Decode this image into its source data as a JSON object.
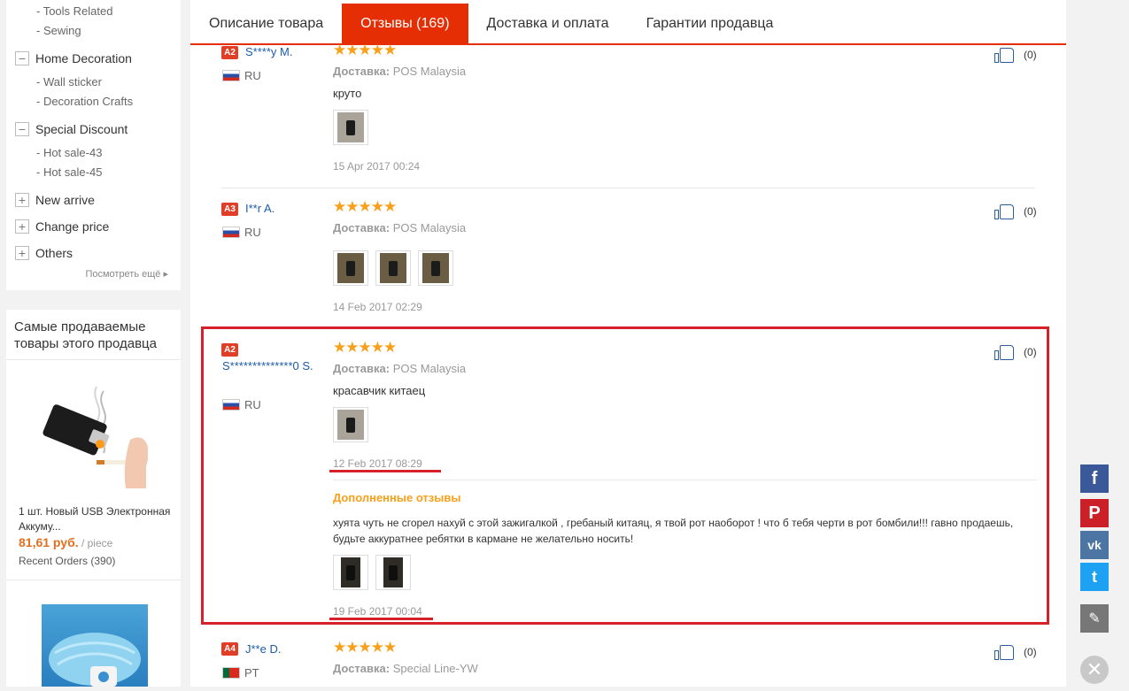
{
  "sidebar": {
    "subs_top": [
      "- Tools Related",
      "- Sewing"
    ],
    "home_decoration": {
      "label": "Home Decoration",
      "toggle": "−",
      "subs": [
        "- Wall sticker",
        "- Decoration Crafts"
      ]
    },
    "special_discount": {
      "label": "Special Discount",
      "toggle": "−",
      "subs": [
        "- Hot sale-43",
        "- Hot sale-45"
      ]
    },
    "new_arrive": {
      "label": "New arrive",
      "toggle": "+"
    },
    "change_price": {
      "label": "Change price",
      "toggle": "+"
    },
    "others": {
      "label": "Others",
      "toggle": "+"
    },
    "more": "Посмотреть ещё ▸"
  },
  "bestsellers": {
    "title": "Самые продаваемые товары этого продавца",
    "product": {
      "name": "1 шт. Новый USB Электронная Аккуму...",
      "price": "81,61 руб.",
      "unit": " / piece",
      "orders": "Recent Orders (390)"
    }
  },
  "tabs": [
    "Описание товара",
    "Отзывы (169)",
    "Доставка и оплата",
    "Гарантии продавца"
  ],
  "active_tab": 1,
  "labels": {
    "delivery": "Доставка:",
    "additional_reviews": "Дополненные отзывы"
  },
  "reviews": [
    {
      "level": "A2",
      "user": "S****y M.",
      "country": "RU",
      "stars": "★★★★★",
      "shipping": "POS Malaysia",
      "text": "круто",
      "date": "15 Apr 2017 00:24",
      "likes": "(0)"
    },
    {
      "level": "A3",
      "user": "I**r A.",
      "country": "RU",
      "stars": "★★★★★",
      "shipping": "POS Malaysia",
      "text": "",
      "date": "14 Feb 2017 02:29",
      "likes": "(0)"
    },
    {
      "level": "A2",
      "user": "S**************0 S.",
      "country": "RU",
      "stars": "★★★★★",
      "shipping": "POS Malaysia",
      "text": "красавчик китаец",
      "date": "12 Feb 2017 08:29",
      "likes": "(0)",
      "additional": {
        "text": "хуята чуть не сгорел нахуй с этой зажигалкой , гребаный китаяц, я твой рот наоборот ! что б тебя черти в рот бомбили!!! гавно продаешь, будьте аккуратнее ребятки в кармане не желательно носить!",
        "date": "19 Feb 2017 00:04"
      }
    },
    {
      "level": "A4",
      "user": "J**e D.",
      "country": "PT",
      "stars": "★★★★★",
      "shipping": "Special Line-YW",
      "likes": "(0)"
    }
  ],
  "share": [
    "f",
    "P",
    "vk",
    "t",
    "✎"
  ],
  "close": "✕",
  "colors": {
    "accent": "#e62e04",
    "star": "#f9a01b",
    "link": "#1c5da8",
    "highlight": "#d6202a"
  }
}
